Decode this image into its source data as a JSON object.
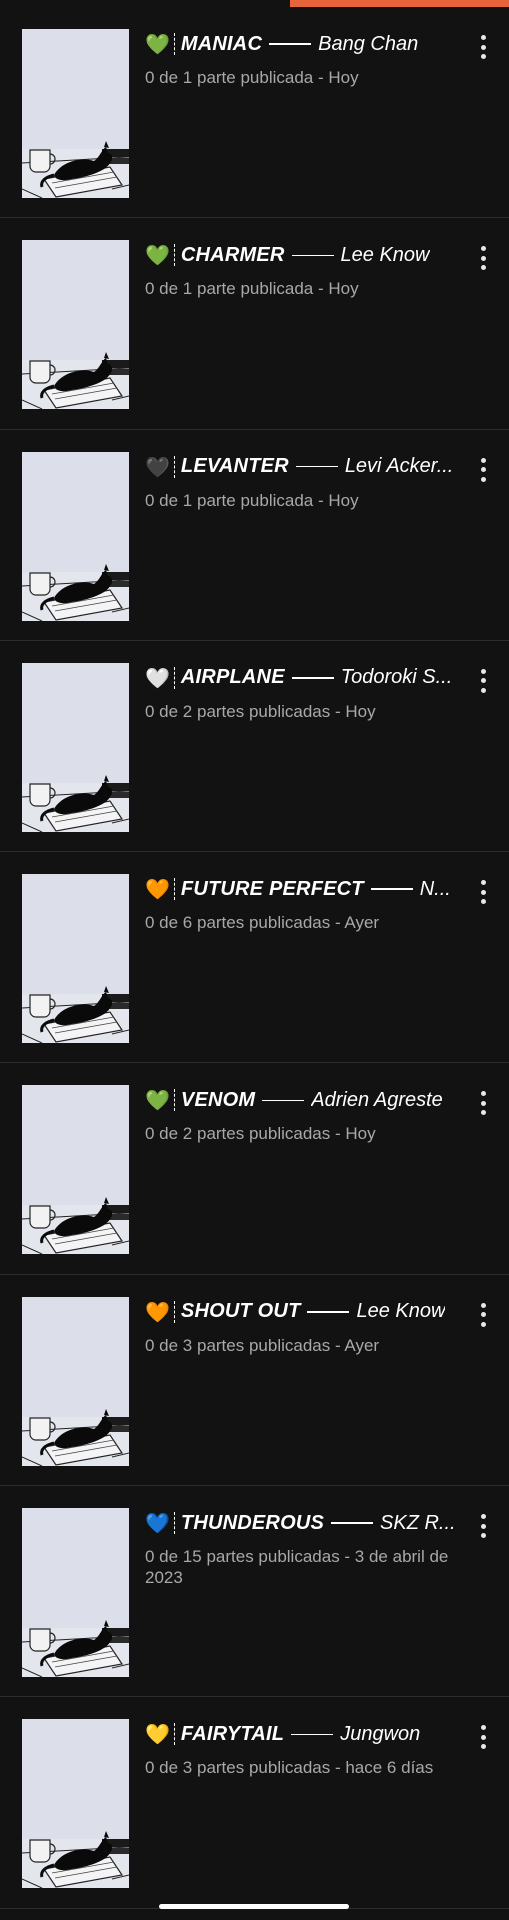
{
  "progress": 0.43,
  "colors": {
    "background": "#121212",
    "accent": "#e8643a",
    "meta_text": "#a8a8a8"
  },
  "stories": [
    {
      "emoji": "💚",
      "title": "MANIAC",
      "character": "Bang Chan",
      "meta": "0 de 1 parte publicada - Hoy"
    },
    {
      "emoji": "💚",
      "title": "CHARMER",
      "character": "Lee Know",
      "meta": "0 de 1 parte publicada - Hoy"
    },
    {
      "emoji": "🖤",
      "title": "LEVANTER",
      "character": "Levi Acker...",
      "meta": "0 de 1 parte publicada - Hoy"
    },
    {
      "emoji": "🤍",
      "title": "AIRPLANE",
      "character": "Todoroki S...",
      "meta": "0 de 2 partes publicadas - Hoy"
    },
    {
      "emoji": "🧡",
      "title": "FUTURE PERFECT",
      "character": "N...",
      "meta": "0 de 6 partes publicadas - Ayer"
    },
    {
      "emoji": "💚",
      "title": "VENOM",
      "character": "Adrien Agreste",
      "meta": "0 de 2 partes publicadas - Hoy"
    },
    {
      "emoji": "🧡",
      "title": "SHOUT OUT",
      "character": "Lee Know",
      "meta": "0 de 3 partes publicadas - Ayer"
    },
    {
      "emoji": "💙",
      "title": "THUNDEROUS",
      "character": "SKZ R...",
      "meta": "0 de 15 partes publicadas - 3 de abril de 2023"
    },
    {
      "emoji": "💛",
      "title": "FAIRYTAIL",
      "character": "Jungwon",
      "meta": "0 de 3 partes publicadas - hace 6 días"
    }
  ]
}
